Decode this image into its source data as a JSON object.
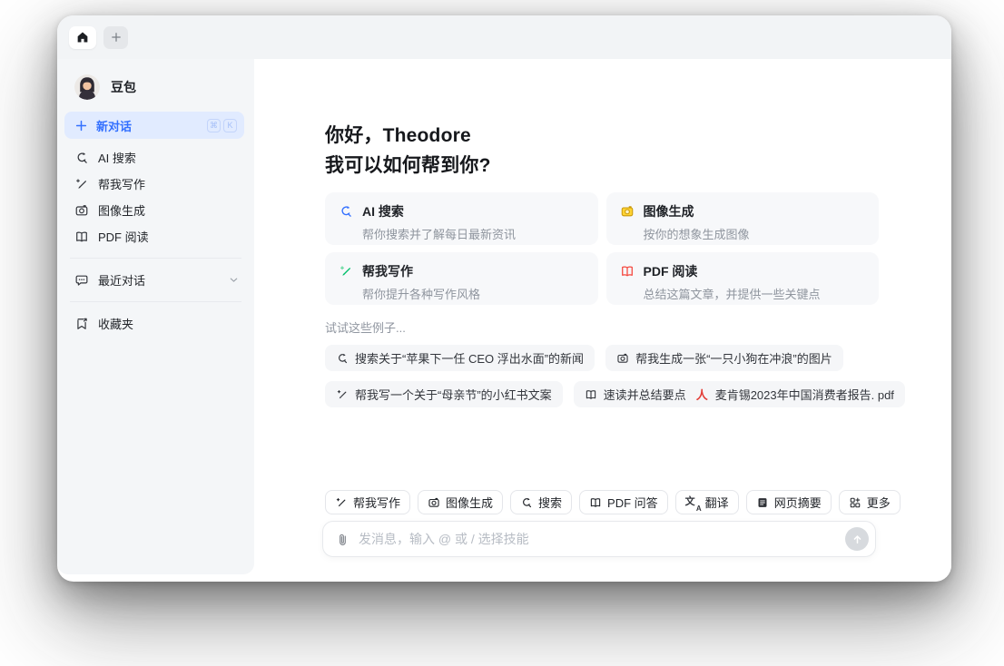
{
  "colors": {
    "accent_blue": "#3370ff",
    "active_item_bg": "#e1ebff",
    "sidebar_bg": "#f4f6f8",
    "card_bg": "#f7f8fa",
    "green": "#00bf6a",
    "yellow": "#ffd333",
    "red": "#f5483f",
    "text_secondary": "#8f959e"
  },
  "tabbar": {
    "tabs": [
      {
        "icon": "home-icon",
        "active": true
      },
      {
        "icon": "plus-icon",
        "active": false
      }
    ]
  },
  "sidebar": {
    "profile": {
      "name": "豆包",
      "avatar": "doubao-girl-avatar"
    },
    "new_chat": {
      "label": "新对话",
      "icon": "plus-icon",
      "shortcut": [
        "⌘",
        "K"
      ]
    },
    "items": [
      {
        "icon": "ai-search-icon",
        "label": "AI 搜索"
      },
      {
        "icon": "write-icon",
        "label": "帮我写作"
      },
      {
        "icon": "image-gen-icon",
        "label": "图像生成"
      },
      {
        "icon": "pdf-read-icon",
        "label": "PDF 阅读"
      }
    ],
    "recent": {
      "icon": "chat-bubble-icon",
      "label": "最近对话",
      "collapse_icon": "chevron-down-icon"
    },
    "favorites": {
      "icon": "bookmark-icon",
      "label": "收藏夹"
    }
  },
  "main": {
    "greeting_line1": "你好，Theodore",
    "greeting_line2": "我可以如何帮到你?",
    "cards": [
      {
        "icon": "ai-search-icon",
        "title": "AI 搜索",
        "desc": "帮你搜索并了解每日最新资讯",
        "icon_color": "#3370ff"
      },
      {
        "icon": "image-gen-icon",
        "title": "图像生成",
        "desc": "按你的想象生成图像",
        "icon_color": "#ffd333"
      },
      {
        "icon": "write-icon",
        "title": "帮我写作",
        "desc": "帮你提升各种写作风格",
        "icon_color": "#00bf6a"
      },
      {
        "icon": "pdf-read-icon",
        "title": "PDF 阅读",
        "desc": "总结这篇文章，并提供一些关键点",
        "icon_color": "#f5483f"
      }
    ],
    "examples_title": "试试这些例子...",
    "examples": [
      {
        "icon": "ai-search-icon",
        "text": "搜索关于“苹果下一任 CEO 浮出水面”的新闻"
      },
      {
        "icon": "image-gen-icon",
        "text": "帮我生成一张“一只小狗在冲浪”的图片"
      },
      {
        "icon": "write-icon",
        "text": "帮我写一个关于“母亲节”的小红书文案"
      },
      {
        "icon": "pdf-read-icon",
        "text": "速读并总结要点",
        "file_icon": "pdf-file-icon",
        "file": "麦肯锡2023年中国消费者报告. pdf"
      }
    ],
    "skills": [
      {
        "icon": "write-icon",
        "label": "帮我写作"
      },
      {
        "icon": "image-gen-icon",
        "label": "图像生成"
      },
      {
        "icon": "ai-search-icon",
        "label": "搜索"
      },
      {
        "icon": "pdf-read-icon",
        "label": "PDF 问答"
      },
      {
        "icon": "translate-icon",
        "label": "翻译"
      },
      {
        "icon": "webpage-summary-icon",
        "label": "网页摘要"
      },
      {
        "icon": "more-grid-icon",
        "label": "更多"
      }
    ],
    "input": {
      "placeholder": "发消息，输入 @ 或 / 选择技能",
      "left_icon": "paperclip-icon",
      "send_icon": "arrow-up-icon"
    }
  }
}
